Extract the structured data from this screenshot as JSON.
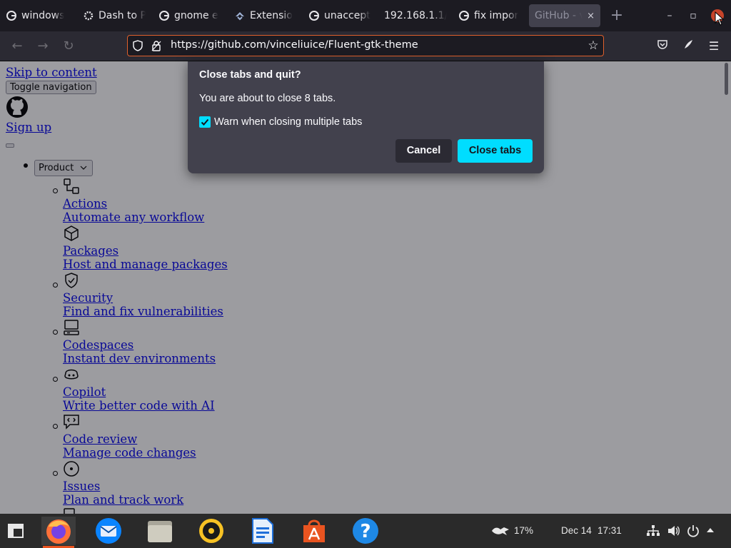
{
  "tabs": [
    {
      "label": "windows",
      "favicon": "google-icon"
    },
    {
      "label": "Dash to P",
      "favicon": "gear-icon"
    },
    {
      "label": "gnome e",
      "favicon": "google-icon"
    },
    {
      "label": "Extensio",
      "favicon": "gnome-extensions-icon"
    },
    {
      "label": "unaccept",
      "favicon": "google-icon"
    },
    {
      "label": "192.168.1.1/",
      "favicon": ""
    },
    {
      "label": "fix impor",
      "favicon": "google-icon"
    },
    {
      "label": "GitHub - v",
      "favicon": "",
      "active": true,
      "close": "×"
    }
  ],
  "nav": {
    "url": "https://github.com/vinceliuice/Fluent-gtk-theme"
  },
  "page": {
    "skip_link": "Skip to content",
    "toggle_nav": "Toggle navigation",
    "sign_up": "Sign up",
    "product_button": "Product",
    "menu_items": [
      {
        "icon": "workflow-icon",
        "title": "Actions",
        "desc": "Automate any workflow"
      },
      {
        "icon": "package-icon",
        "title": "Packages",
        "desc": "Host and manage packages"
      },
      {
        "icon": "shield-check-icon",
        "title": "Security",
        "desc": "Find and fix vulnerabilities"
      },
      {
        "icon": "codespaces-icon",
        "title": "Codespaces",
        "desc": "Instant dev environments"
      },
      {
        "icon": "copilot-icon",
        "title": "Copilot",
        "desc": "Write better code with AI"
      },
      {
        "icon": "code-review-icon",
        "title": "Code review",
        "desc": "Manage code changes"
      },
      {
        "icon": "issue-icon",
        "title": "Issues",
        "desc": "Plan and track work"
      }
    ]
  },
  "dialog": {
    "title": "Close tabs and quit?",
    "message": "You are about to close 8 tabs.",
    "checkbox_label": "Warn when closing multiple tabs",
    "checkbox_checked": true,
    "cancel_label": "Cancel",
    "confirm_label": "Close tabs"
  },
  "taskbar": {
    "apps": [
      "firefox-icon",
      "thunderbird-icon",
      "files-icon",
      "rhythmbox-icon",
      "writer-icon",
      "software-center-icon",
      "help-icon"
    ],
    "battery": "17%",
    "date": "Dec 14",
    "time": "17:31"
  },
  "colors": {
    "accent": "#00ddff",
    "urlbar_border": "#e0602c",
    "taskbar_indicator": "#e95420"
  }
}
